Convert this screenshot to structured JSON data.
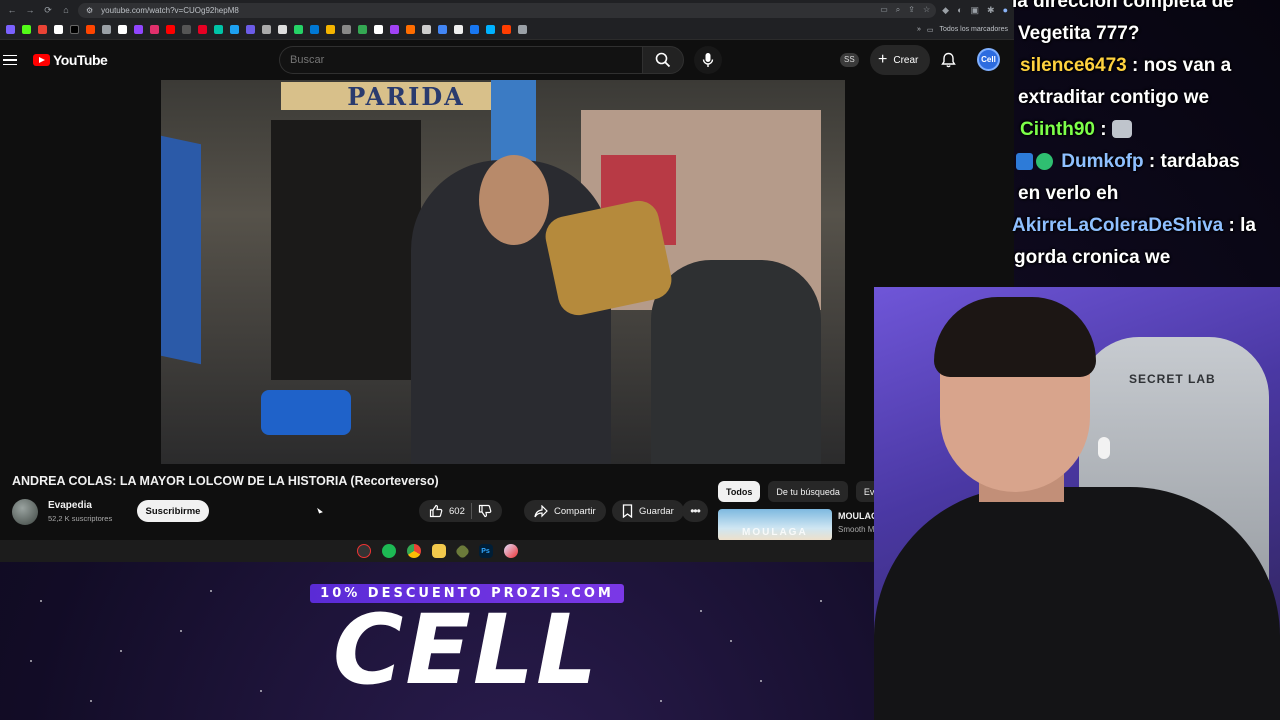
{
  "browser": {
    "url": "youtube.com/watch?v=CUOg92hepM8",
    "bookmarks_folder": "Todos los marcadores"
  },
  "youtube": {
    "logo_text": "YouTube",
    "search_placeholder": "Buscar",
    "ss_badge": "SS",
    "create_label": "Crear",
    "avatar_text": "Cell",
    "video_sign": "PARIDA",
    "video_title": "ANDREA COLAS: LA MAYOR LOLCOW DE LA HISTORIA (Recorteverso)",
    "channel": {
      "name": "Evapedia",
      "subscribers": "52,2 K suscriptores",
      "subscribe_label": "Suscribirme"
    },
    "actions": {
      "likes": "602",
      "share_label": "Compartir",
      "save_label": "Guardar"
    },
    "chips": [
      "Todos",
      "De tu búsqueda",
      "Eva"
    ],
    "recommended": {
      "thumb_text": "MOULAGA",
      "title": "MOULAG",
      "subtitle": "Smooth M"
    }
  },
  "chat": [
    {
      "user": "",
      "message": "la dirección completa de"
    },
    {
      "user": "",
      "message": "Vegetita 777?"
    },
    {
      "user": "silence6473",
      "message": ": nos van a",
      "color": "#ffd23f"
    },
    {
      "user": "",
      "message": "extraditar contigo we"
    },
    {
      "user": "Ciinth90",
      "message": ":",
      "color": "#7dff4a",
      "emote": "cat-emote"
    },
    {
      "user": "Dumkofp",
      "message": ": tardabas",
      "color": "#8fc0ff",
      "badges": true
    },
    {
      "user": "",
      "message": "en verlo eh"
    },
    {
      "user": "AkirreLaColeraDeShiva",
      "message": ": la",
      "color": "#8fc0ff"
    },
    {
      "user": "",
      "message": "gorda cronica we"
    }
  ],
  "promo": {
    "banner": "10% DESCUENTO PROZIS.COM",
    "logo": "CELL"
  },
  "webcam": {
    "chair_brand": "SECRET LAB"
  },
  "colors": {
    "youtube_red": "#ff0000",
    "promo_purple": "#6a32de",
    "webcam_bg": "#5b45c0"
  }
}
